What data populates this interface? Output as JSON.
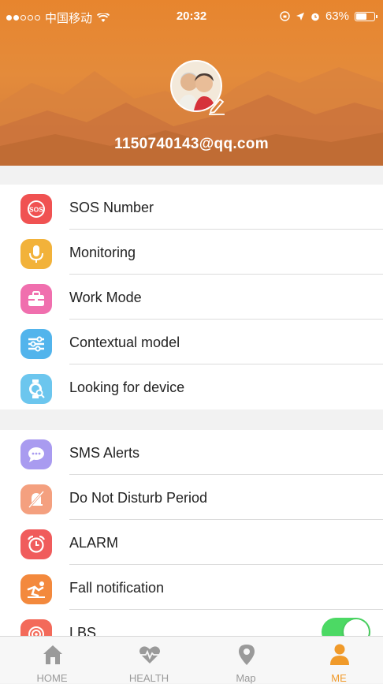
{
  "status_bar": {
    "carrier": "中国移动",
    "time": "20:32",
    "battery": "63%",
    "battery_level": 0.63
  },
  "profile": {
    "email": "1150740143@qq.com",
    "avatar_icon": "avatar-photo",
    "edit_icon": "pencil-icon"
  },
  "menu_group_1": [
    {
      "label": "SOS Number",
      "icon": "sos-icon",
      "color": "#f05252"
    },
    {
      "label": "Monitoring",
      "icon": "microphone-icon",
      "color": "#f2b23a"
    },
    {
      "label": "Work Mode",
      "icon": "briefcase-icon",
      "color": "#f06fae"
    },
    {
      "label": "Contextual model",
      "icon": "sliders-icon",
      "color": "#52b4ec"
    },
    {
      "label": "Looking for device",
      "icon": "watch-search-icon",
      "color": "#6cc6ee"
    }
  ],
  "menu_group_2": [
    {
      "label": "SMS Alerts",
      "icon": "chat-bubble-icon",
      "color": "#a99bf0"
    },
    {
      "label": "Do Not Disturb Period",
      "icon": "bell-off-icon",
      "color": "#f4a07f"
    },
    {
      "label": "ALARM",
      "icon": "alarm-clock-icon",
      "color": "#f05c5c"
    },
    {
      "label": "Fall notification",
      "icon": "fall-person-icon",
      "color": "#f3893d"
    },
    {
      "label": "LBS",
      "icon": "location-signal-icon",
      "color": "#f36a5a",
      "toggle_on": true
    }
  ],
  "tabs": [
    {
      "label": "HOME",
      "icon": "home-icon",
      "active": false
    },
    {
      "label": "HEALTH",
      "icon": "heart-pulse-icon",
      "active": false
    },
    {
      "label": "Map",
      "icon": "map-pin-icon",
      "active": false
    },
    {
      "label": "ME",
      "icon": "person-icon",
      "active": true
    }
  ],
  "colors": {
    "header": "#e7852e",
    "accent": "#f09a2a",
    "toggle_on": "#4cd964"
  }
}
